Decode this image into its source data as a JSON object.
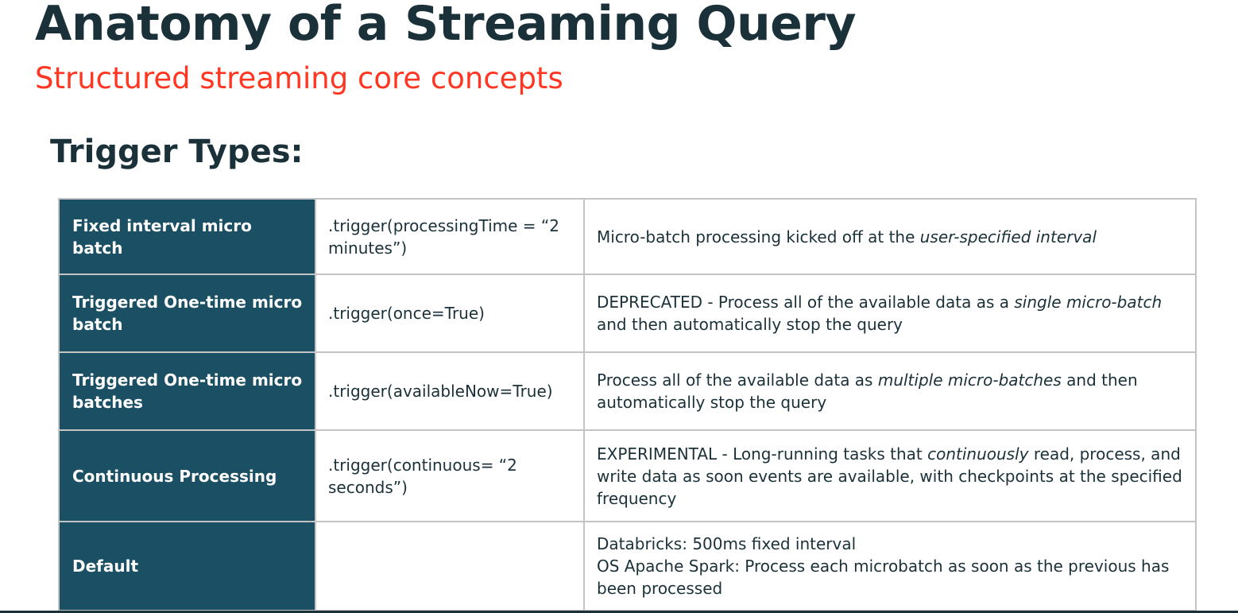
{
  "slide": {
    "title": "Anatomy of a Streaming Query",
    "subtitle": "Structured streaming core concepts",
    "section_heading": "Trigger Types:"
  },
  "colors": {
    "title": "#1b3139",
    "subtitle_accent": "#ff3621",
    "header_cell_bg": "#1b4f63",
    "header_cell_text": "#ffffff",
    "grid_line": "#c4c4c4"
  },
  "trigger_table": {
    "rows": [
      {
        "name": "Fixed interval micro batch",
        "code": ".trigger(processingTime = “2 minutes”)",
        "description": [
          {
            "text": "Micro-batch processing kicked off at the "
          },
          {
            "text": "user-specified interval",
            "italic": true
          }
        ]
      },
      {
        "name": "Triggered One-time micro batch",
        "code": ".trigger(once=True)",
        "description": [
          {
            "text": "DEPRECATED - Process all of the available data as a "
          },
          {
            "text": "single micro-batch",
            "italic": true
          },
          {
            "text": " and then automatically stop the query"
          }
        ]
      },
      {
        "name": "Triggered One-time micro batches",
        "code": ".trigger(availableNow=True)",
        "description": [
          {
            "text": "Process all of the available data as "
          },
          {
            "text": "multiple micro-batches",
            "italic": true
          },
          {
            "text": " and then automatically stop the query"
          }
        ]
      },
      {
        "name": "Continuous Processing",
        "code": ".trigger(continuous= “2 seconds”)",
        "description": [
          {
            "text": "EXPERIMENTAL - Long-running tasks that "
          },
          {
            "text": "continuously",
            "italic": true
          },
          {
            "text": " read, process, and write data as soon events are available, with checkpoints at the specified frequency"
          }
        ]
      },
      {
        "name": "Default",
        "code": "",
        "description_lines": [
          "Databricks: 500ms fixed interval",
          "OS Apache Spark: Process each microbatch as soon as the previous has been processed"
        ]
      }
    ]
  }
}
